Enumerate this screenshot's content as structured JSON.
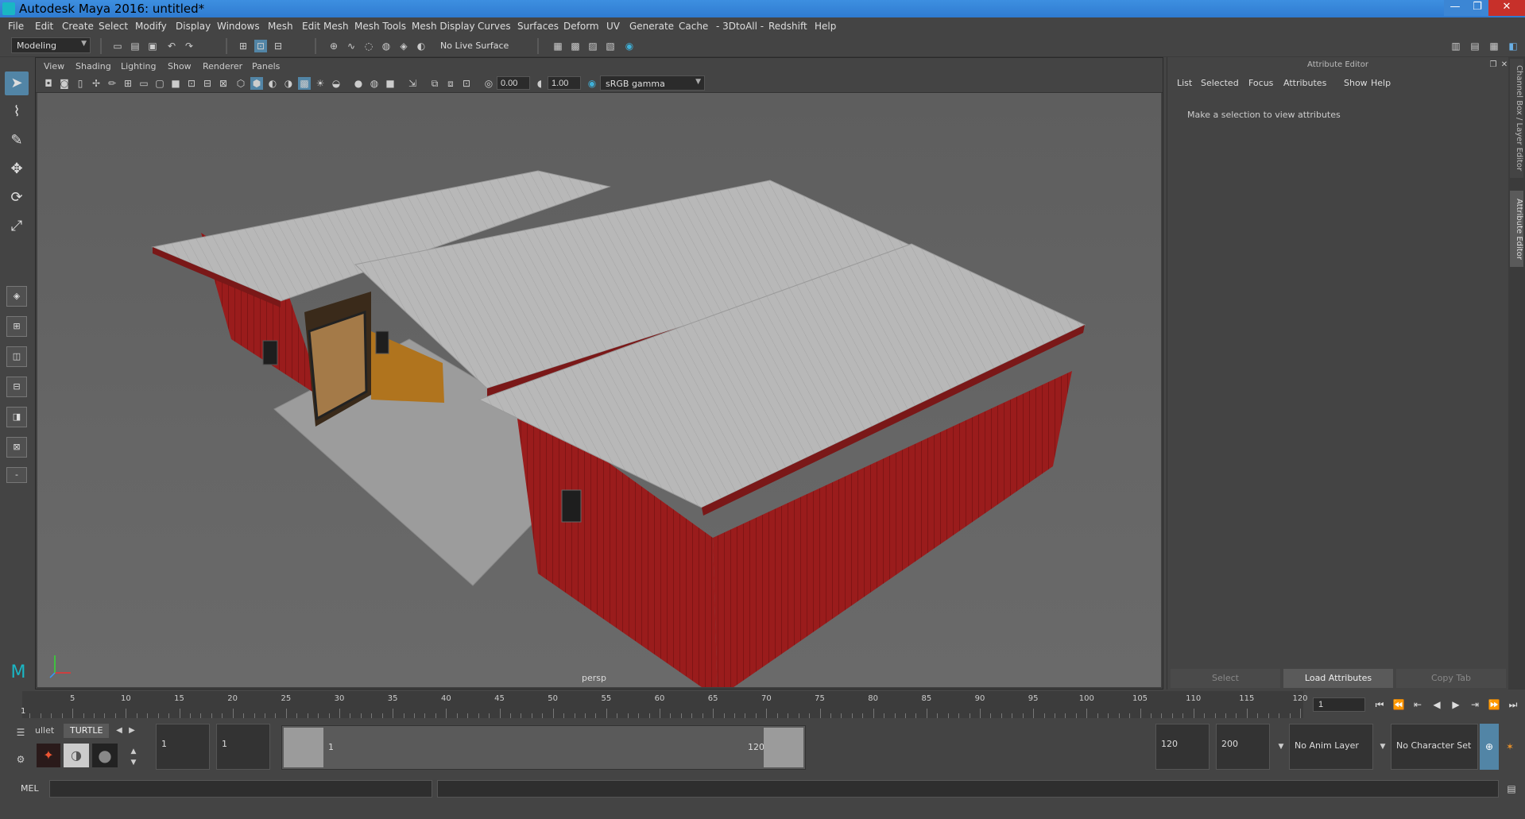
{
  "window": {
    "title": "Autodesk Maya 2016: untitled*",
    "min": "—",
    "max": "❐",
    "close": "✕"
  },
  "menu": [
    "File",
    "Edit",
    "Create",
    "Select",
    "Modify",
    "Display",
    "Windows",
    "Mesh",
    "Edit Mesh",
    "Mesh Tools",
    "Mesh Display",
    "Curves",
    "Surfaces",
    "Deform",
    "UV",
    "Generate",
    "Cache",
    "- 3DtoAll -",
    "Redshift",
    "Help"
  ],
  "status": {
    "mode": "Modeling",
    "live_surface": "No Live Surface"
  },
  "panel": {
    "menu": [
      "View",
      "Shading",
      "Lighting",
      "Show",
      "Renderer",
      "Panels"
    ],
    "exposure": "0.00",
    "gamma": "1.00",
    "colorspace": "sRGB gamma",
    "camera": "persp"
  },
  "attribute_editor": {
    "title": "Attribute Editor",
    "menu": [
      "List",
      "Selected",
      "Focus",
      "Attributes",
      "Show",
      "Help"
    ],
    "message": "Make a selection to view attributes",
    "buttons": {
      "select": "Select",
      "load": "Load Attributes",
      "copy": "Copy Tab"
    },
    "side_tabs": {
      "channel_box": "Channel Box / Layer Editor",
      "attr": "Attribute Editor"
    }
  },
  "timeline": {
    "ticks": [
      "5",
      "10",
      "15",
      "20",
      "25",
      "30",
      "35",
      "40",
      "45",
      "50",
      "55",
      "60",
      "65",
      "70",
      "75",
      "80",
      "85",
      "90",
      "95",
      "100",
      "105",
      "110",
      "115",
      "120"
    ],
    "start_marker": "1",
    "current_frame": "1"
  },
  "range": {
    "shelf_tabs": [
      "ullet",
      "TURTLE"
    ],
    "start": "1",
    "inner_start": "1",
    "range_start_label": "1",
    "range_end_label": "120",
    "end": "120",
    "anim_end": "200",
    "anim_layer": "No Anim Layer",
    "character_set": "No Character Set"
  },
  "cmd": {
    "mel": "MEL"
  },
  "colors": {
    "barn_red": "#9a1c1c",
    "roof": "#b5b5b5",
    "slab": "#9a9a9a",
    "accent": "#5285a6"
  }
}
